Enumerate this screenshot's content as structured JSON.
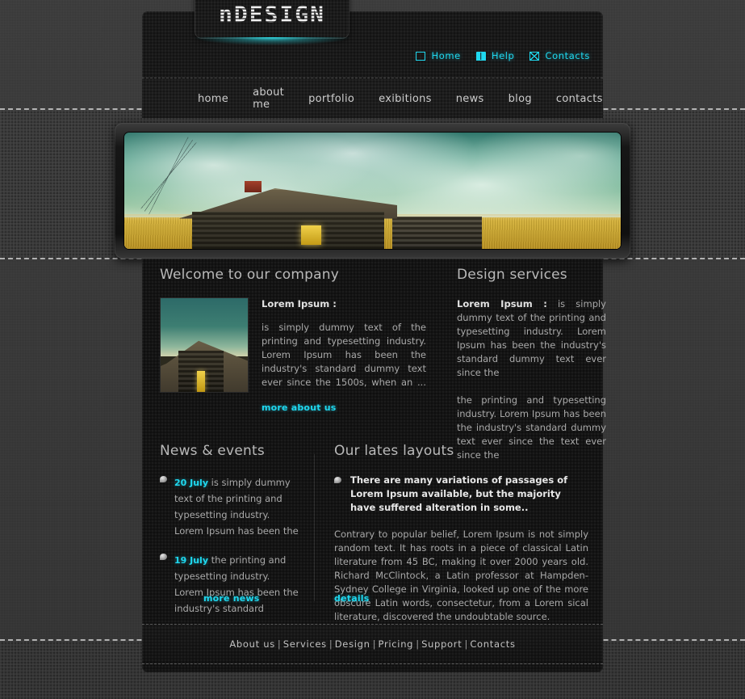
{
  "site": {
    "logo_text": "nDESIGN"
  },
  "topnav": {
    "items": [
      {
        "label": "Home",
        "icon": "square-icon"
      },
      {
        "label": "Help",
        "icon": "book-icon"
      },
      {
        "label": "Contacts",
        "icon": "mail-icon"
      }
    ]
  },
  "menu": {
    "items": [
      {
        "label": "home"
      },
      {
        "label": "about me"
      },
      {
        "label": "portfolio"
      },
      {
        "label": "exibitions"
      },
      {
        "label": "news"
      },
      {
        "label": "blog"
      },
      {
        "label": "contacts"
      }
    ]
  },
  "hero": {
    "alt": "abandoned wooden farmhouse in a golden field under green stormy sky"
  },
  "welcome": {
    "title": "Welcome to our company",
    "lead": "Lorem Ipsum :",
    "body": "is simply dummy text of the printing and typesetting industry. Lorem Ipsum has been the industry's standard dummy text ever since the 1500s, when an ...",
    "link": "more about us",
    "thumb_alt": "wooden farmhouse roof against cloudy sky"
  },
  "services": {
    "title": "Design services",
    "lead": "Lorem Ipsum :",
    "body_1": "is simply dummy text of the printing and typesetting industry. Lorem Ipsum has been the industry's standard dummy text ever since the",
    "body_2": "the printing and typesetting industry. Lorem Ipsum has been the industry's standard dummy text ever since the text ever since the"
  },
  "news": {
    "title": "News & events",
    "items": [
      {
        "date": "20 July",
        "text": " is simply dummy text of the printing and typesetting industry. Lorem Ipsum has been the"
      },
      {
        "date": "19 July",
        "text": " the printing and typesetting industry. Lorem Ipsum has been the industry's standard"
      }
    ],
    "link": "more news"
  },
  "layouts": {
    "title": "Our lates layouts",
    "highlight": "There are many variations of passages of Lorem Ipsum available, but the majority have suffered alteration in some..",
    "body": "Contrary to popular belief, Lorem Ipsum is not simply random text. It has roots in a piece of classical Latin literature from 45 BC, making it over 2000 years old. Richard McClintock, a Latin professor at Hampden-Sydney College in Virginia, looked up one of the more obscure Latin words, consectetur, from a Lorem sical literature, discovered the undoubtable source.",
    "link": "details"
  },
  "footer": {
    "separator": "|",
    "items": [
      {
        "label": "About us"
      },
      {
        "label": "Services"
      },
      {
        "label": "Design"
      },
      {
        "label": "Pricing"
      },
      {
        "label": "Support"
      },
      {
        "label": "Contacts"
      }
    ]
  },
  "colors": {
    "accent_cyan": "#1fd8ef",
    "panel_dark": "#141414",
    "header_dark": "#191919",
    "page_bg": "#333333",
    "text_body": "#a9a9a9",
    "text_heading": "#b9b9b9"
  }
}
